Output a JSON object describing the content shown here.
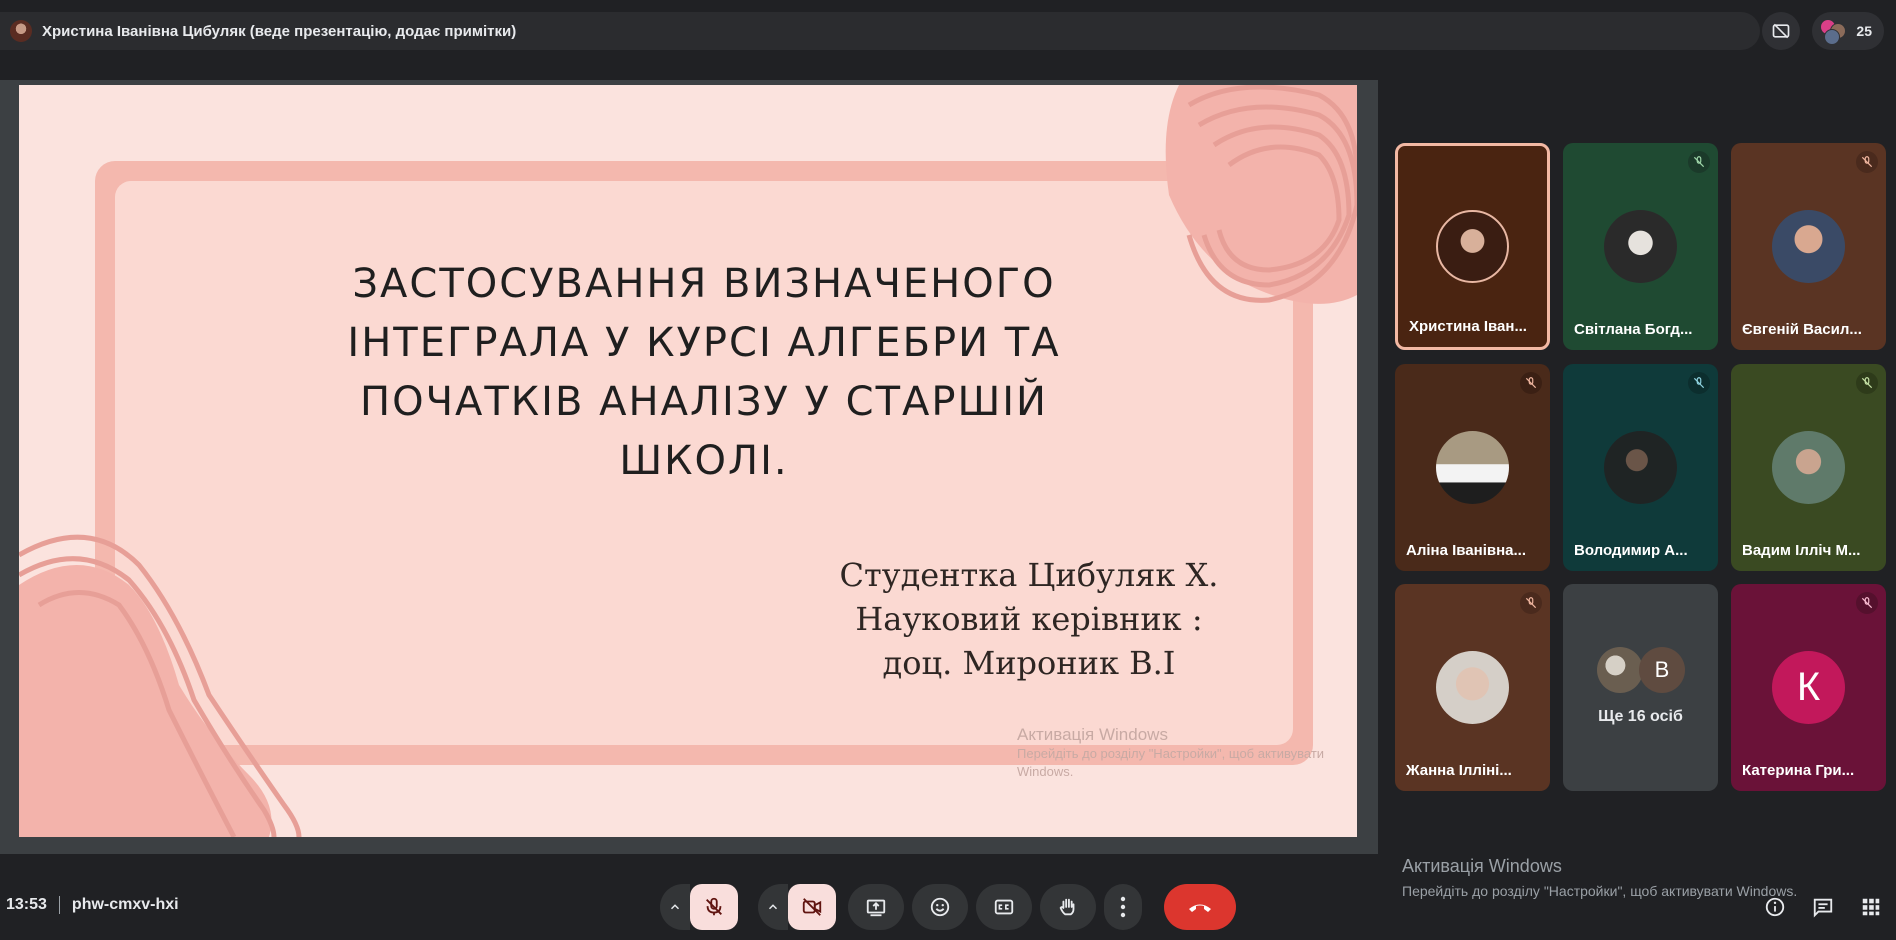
{
  "top_bar": {
    "presenter_label": "Христина Іванівна Цибуляк (веде презентацію, додає примітки)",
    "people_count": "25"
  },
  "slide": {
    "title_lines": [
      "ЗАСТОСУВАННЯ ВИЗНАЧЕНОГО",
      "ІНТЕГРАЛА У КУРСІ АЛГЕБРИ ТА",
      "ПОЧАТКІВ АНАЛІЗУ У СТАРШІЙ",
      "ШКОЛІ."
    ],
    "subtitle_lines": [
      "Студентка Цибуляк Х.",
      "Науковий керівник :",
      "доц. Мироник В.І"
    ],
    "watermark_title": "Активація Windows",
    "watermark_text": "Перейдіть до розділу \"Настройки\", щоб активувати Windows."
  },
  "participants": [
    {
      "name": "Христина Іван...",
      "muted": false,
      "active": true,
      "bg": "#4a2411",
      "mic_bg": "",
      "avatar_bg": "#6b3a2a"
    },
    {
      "name": "Світлана Богд...",
      "muted": true,
      "active": false,
      "bg": "#1f4a32",
      "mic_bg": "#1b3a2a",
      "avatar_bg": "#3b3b3b"
    },
    {
      "name": "Євгеній Васил...",
      "muted": true,
      "active": false,
      "bg": "#5a3423",
      "mic_bg": "#4a2a1d",
      "avatar_bg": "#4c3a30"
    },
    {
      "name": "Аліна Іванівна...",
      "muted": true,
      "active": false,
      "bg": "#4a2a1a",
      "mic_bg": "#3b2014",
      "avatar_bg": "#8f8370"
    },
    {
      "name": "Володимир А...",
      "muted": true,
      "active": false,
      "bg": "#0f3a3a",
      "mic_bg": "#0c2e2e",
      "avatar_bg": "#2b3030"
    },
    {
      "name": "Вадим Ілліч М...",
      "muted": true,
      "active": false,
      "bg": "#3a4a22",
      "mic_bg": "#2e3b1a",
      "avatar_bg": "#7a8a80"
    },
    {
      "name": "Жанна Ілліні...",
      "muted": true,
      "active": false,
      "bg": "#5a3423",
      "mic_bg": "#4a2a1d",
      "avatar_bg": "#d6c2b3"
    },
    {
      "name": "Катерина Гри...",
      "muted": true,
      "active": false,
      "bg": "#6a1238",
      "mic_bg": "#55102d",
      "avatar_bg": "#c2185b",
      "letter": "К"
    }
  ],
  "more_tile": {
    "letter": "В",
    "label": "Ще 16 осіб"
  },
  "windows_watermark": {
    "title": "Активація Windows",
    "text": "Перейдіть до розділу \"Настройки\", щоб активувати Windows."
  },
  "bottom_bar": {
    "time": "13:53",
    "meeting_code": "phw-cmxv-hxi"
  },
  "icons": [
    "presenter-avatar",
    "camera-off-icon",
    "people-icon",
    "mic-off-icon",
    "camera-off-icon",
    "present-icon",
    "emoji-icon",
    "captions-icon",
    "raise-hand-icon",
    "more-icon",
    "end-call-icon",
    "info-icon",
    "chat-icon",
    "activities-icon"
  ]
}
